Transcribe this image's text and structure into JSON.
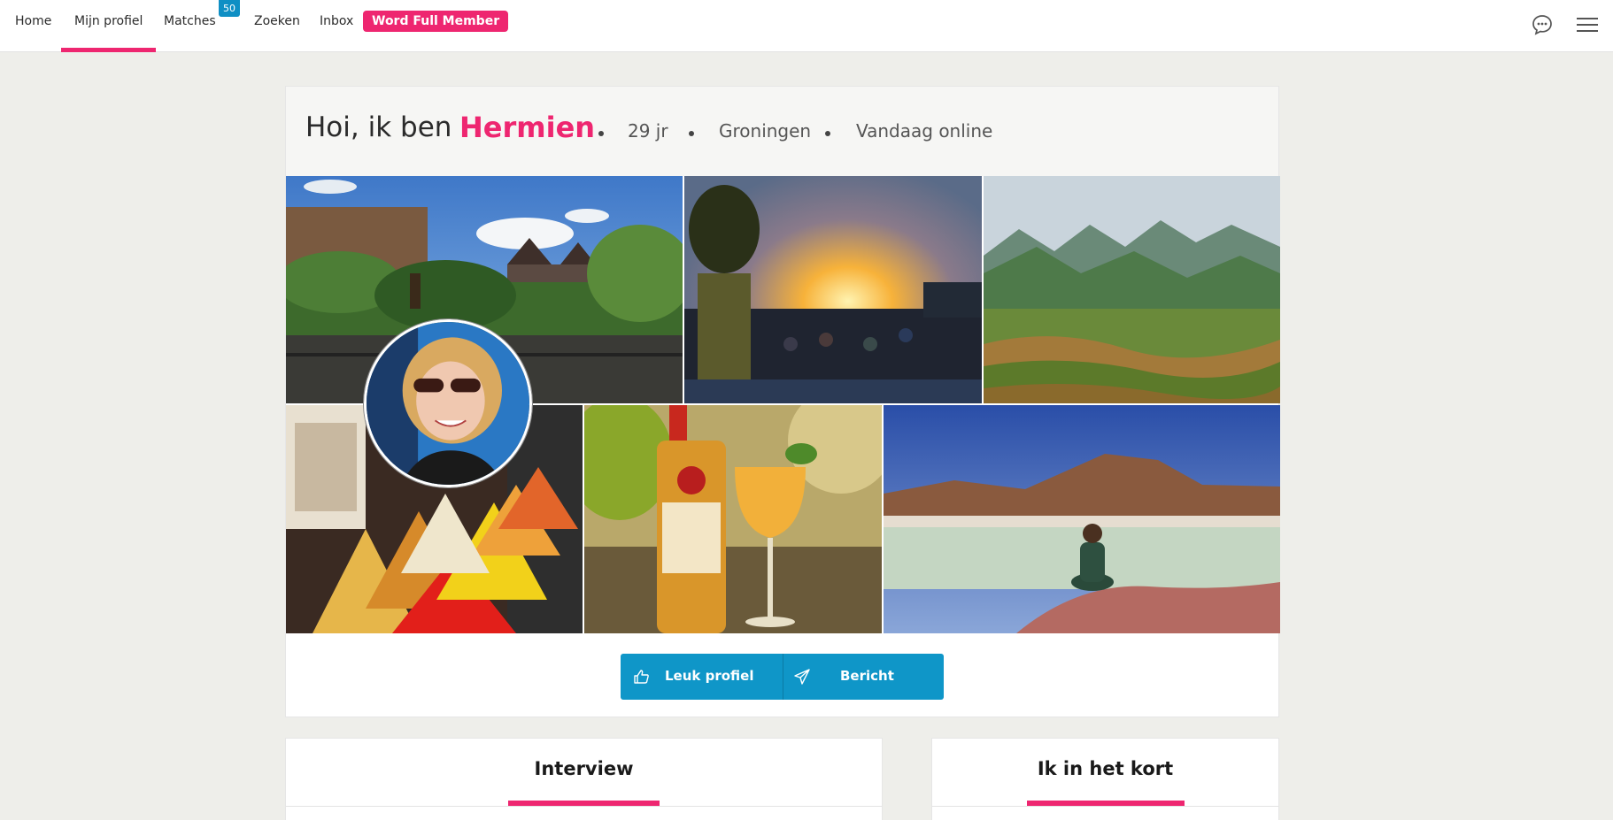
{
  "nav": {
    "items": [
      {
        "label": "Home"
      },
      {
        "label": "Mijn profiel"
      },
      {
        "label": "Matches"
      },
      {
        "label": "Zoeken"
      },
      {
        "label": "Inbox"
      }
    ],
    "active": "Mijn profiel",
    "matches_badge": "50",
    "member_button": "Word Full Member",
    "icons": [
      "chat-icon",
      "menu-icon"
    ]
  },
  "profile": {
    "greeting": "Hoi, ik ben",
    "name": "Hermien",
    "age": "29 jr",
    "city": "Groningen",
    "online_status": "Vandaag online"
  },
  "photos": [
    {
      "subject": "castle-garden"
    },
    {
      "subject": "festival-sunset"
    },
    {
      "subject": "mountain-rice-terraces"
    },
    {
      "subject": "spice-cones"
    },
    {
      "subject": "gin-cocktail"
    },
    {
      "subject": "woman-at-lake"
    }
  ],
  "actions": {
    "like_label": "Leuk profiel",
    "message_label": "Bericht"
  },
  "sections": {
    "interview_title": "Interview",
    "summary_title": "Ik in het kort"
  },
  "colors": {
    "accent": "#ee2670",
    "button": "#0f96c8",
    "badge": "#0f8fc4",
    "background": "#eeeeea"
  }
}
